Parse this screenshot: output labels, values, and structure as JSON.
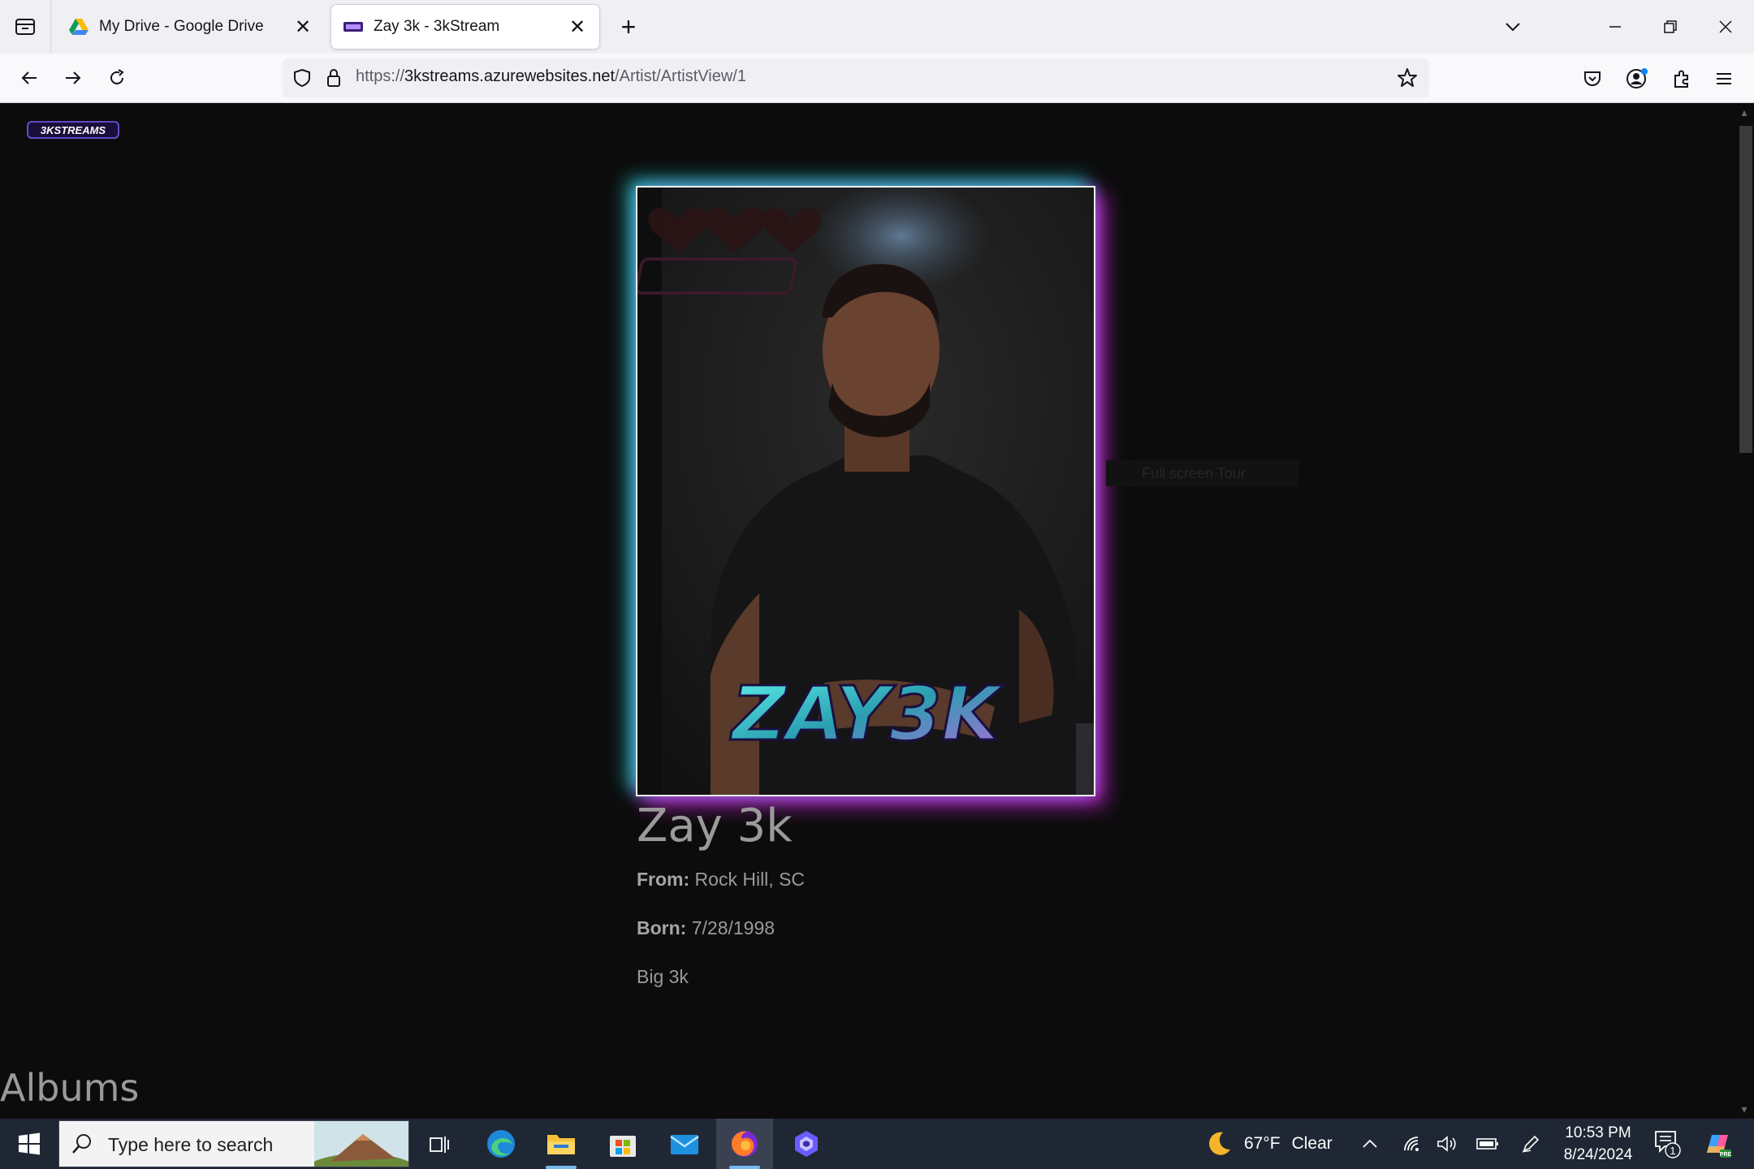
{
  "browser": {
    "tabs": [
      {
        "title": "My Drive - Google Drive",
        "active": false
      },
      {
        "title": "Zay 3k - 3kStream",
        "active": true
      }
    ],
    "url": {
      "scheme": "https://",
      "host": "3kstreams.azurewebsites.net",
      "path": "/Artist/ArtistView/1"
    }
  },
  "site": {
    "logo_text": "3KSTREAMS"
  },
  "artist": {
    "image_logo_text": "ZAY3K",
    "name": "Zay 3k",
    "from_label": "From:",
    "from_value": " Rock Hill, SC",
    "born_label": "Born:",
    "born_value": " 7/28/1998",
    "bio": "Big 3k"
  },
  "ghost_tooltip": "Full screen Tour",
  "sections": {
    "albums_heading": "Albums"
  },
  "taskbar": {
    "search_placeholder": "Type here to search",
    "weather_temp": "67°F",
    "weather_desc": "Clear",
    "time": "10:53 PM",
    "date": "8/24/2024",
    "notification_count": "1"
  },
  "colors": {
    "page_bg": "#0c0c0c",
    "glow_cyan": "#28e6e6",
    "glow_magenta": "#dc28e6",
    "text_gray": "#9a9a9a",
    "taskbar_bg": "#202734"
  }
}
